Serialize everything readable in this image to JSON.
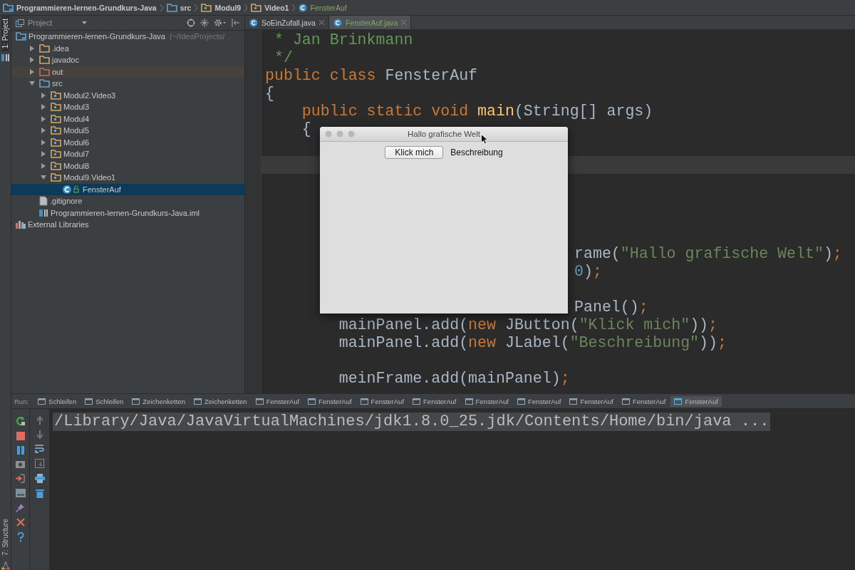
{
  "breadcrumbs": [
    {
      "label": "Programmieren-lernen-Grundkurs-Java",
      "kind": "project"
    },
    {
      "label": "src",
      "kind": "source"
    },
    {
      "label": "Modul9",
      "kind": "package"
    },
    {
      "label": "Video1",
      "kind": "package"
    },
    {
      "label": "FensterAuf",
      "kind": "class"
    }
  ],
  "left_strip": {
    "top_tab": {
      "label": "1: Project",
      "selected": true
    },
    "bottom_tab": {
      "label": "7: Structure",
      "selected": false
    }
  },
  "project_panel": {
    "title": "Project",
    "tree": [
      {
        "label": "Programmieren-lernen-Grundkurs-Java",
        "detail": "(~/IdeaProjects/",
        "kind": "project",
        "selected": false,
        "children": [
          {
            "label": ".idea",
            "kind": "folder",
            "expanded": false,
            "selected": false
          },
          {
            "label": "javadoc",
            "kind": "folder",
            "expanded": false,
            "selected": false
          },
          {
            "label": "out",
            "kind": "excluded",
            "expanded": false,
            "selected": false
          },
          {
            "label": "src",
            "kind": "source",
            "expanded": true,
            "selected": false,
            "children": [
              {
                "label": "Modul2.Video3",
                "kind": "package",
                "expanded": false,
                "selected": false
              },
              {
                "label": "Modul3",
                "kind": "package",
                "expanded": false,
                "selected": false
              },
              {
                "label": "Modul4",
                "kind": "package",
                "expanded": false,
                "selected": false
              },
              {
                "label": "Modul5",
                "kind": "package",
                "expanded": false,
                "selected": false
              },
              {
                "label": "Modul6",
                "kind": "package",
                "expanded": false,
                "selected": false
              },
              {
                "label": "Modul7",
                "kind": "package",
                "expanded": false,
                "selected": false
              },
              {
                "label": "Modul8",
                "kind": "package",
                "expanded": false,
                "selected": false
              },
              {
                "label": "Modul9.Video1",
                "kind": "package",
                "expanded": true,
                "selected": false,
                "children": [
                  {
                    "label": "FensterAuf",
                    "kind": "class",
                    "selected": true
                  }
                ]
              }
            ]
          },
          {
            "label": ".gitignore",
            "kind": "file",
            "selected": false
          },
          {
            "label": "Programmieren-lernen-Grundkurs-Java.iml",
            "kind": "iml",
            "selected": false
          }
        ]
      },
      {
        "label": "External Libraries",
        "kind": "libraries",
        "selected": false
      }
    ]
  },
  "editor": {
    "tabs": [
      {
        "label": "SoEinZufall.java",
        "selected": false
      },
      {
        "label": "FensterAuf.java",
        "selected": true
      }
    ],
    "lines": [
      {
        "kind": "code",
        "current": false,
        "tokens": [
          {
            "kind": "doc",
            "text": " * Jan Brinkmann"
          }
        ]
      },
      {
        "kind": "code",
        "current": false,
        "tokens": [
          {
            "kind": "doc",
            "text": " */"
          }
        ]
      },
      {
        "kind": "code",
        "current": false,
        "tokens": [
          {
            "kind": "keyword",
            "text": "public class "
          },
          {
            "kind": "plain",
            "text": "FensterAuf"
          }
        ]
      },
      {
        "kind": "code",
        "current": false,
        "tokens": [
          {
            "kind": "plain",
            "text": "{"
          }
        ]
      },
      {
        "kind": "code",
        "current": false,
        "tokens": [
          {
            "kind": "keyword",
            "text": "    public static void "
          },
          {
            "kind": "method",
            "text": "main"
          },
          {
            "kind": "plain",
            "text": "(String[] args)"
          }
        ]
      },
      {
        "kind": "code",
        "current": false,
        "tokens": [
          {
            "kind": "plain",
            "text": "    {"
          }
        ]
      },
      {
        "kind": "code",
        "current": false
      },
      {
        "kind": "code",
        "current": true
      },
      {
        "kind": "code",
        "current": false
      },
      {
        "kind": "code",
        "current": false
      },
      {
        "kind": "code",
        "current": false
      },
      {
        "kind": "code",
        "current": false
      },
      {
        "kind": "partial",
        "current": false,
        "tokens": [
          {
            "kind": "plain",
            "text": "rame("
          },
          {
            "kind": "string",
            "text": "\"Hallo grafische Welt\""
          },
          {
            "kind": "plain",
            "text": ")"
          },
          {
            "kind": "keyword",
            "text": ";"
          }
        ]
      },
      {
        "kind": "partial",
        "current": false,
        "tokens": [
          {
            "kind": "number",
            "text": "0"
          },
          {
            "kind": "plain",
            "text": ")"
          },
          {
            "kind": "keyword",
            "text": ";"
          }
        ]
      },
      {
        "kind": "code",
        "current": false
      },
      {
        "kind": "partial",
        "current": false,
        "tokens": [
          {
            "kind": "plain",
            "text": "Panel()"
          },
          {
            "kind": "keyword",
            "text": ";"
          }
        ]
      },
      {
        "kind": "code",
        "current": false,
        "tokens": [
          {
            "kind": "plain",
            "text": "        mainPanel.add("
          },
          {
            "kind": "keyword",
            "text": "new"
          },
          {
            "kind": "plain",
            "text": " JButton("
          },
          {
            "kind": "string",
            "text": "\"Klick mich\""
          },
          {
            "kind": "plain",
            "text": "))"
          },
          {
            "kind": "keyword",
            "text": ";"
          }
        ]
      },
      {
        "kind": "code",
        "current": false,
        "tokens": [
          {
            "kind": "plain",
            "text": "        mainPanel.add("
          },
          {
            "kind": "keyword",
            "text": "new"
          },
          {
            "kind": "plain",
            "text": " JLabel("
          },
          {
            "kind": "string",
            "text": "\"Beschreibung\""
          },
          {
            "kind": "plain",
            "text": "))"
          },
          {
            "kind": "keyword",
            "text": ";"
          }
        ]
      },
      {
        "kind": "code",
        "current": false
      },
      {
        "kind": "code",
        "current": false,
        "tokens": [
          {
            "kind": "plain",
            "text": "        meinFrame.add(mainPanel)"
          },
          {
            "kind": "keyword",
            "text": ";"
          }
        ]
      }
    ]
  },
  "app_window": {
    "title": "Hallo grafische Welt",
    "button": "Klick mich",
    "label": "Beschreibung"
  },
  "run": {
    "label": "Run:",
    "tabs": [
      {
        "label": "Schleifen",
        "selected": false
      },
      {
        "label": "Schleifen",
        "selected": false
      },
      {
        "label": "Zeichenketten",
        "selected": false
      },
      {
        "label": "Zeichenketten",
        "selected": false
      },
      {
        "label": "FensterAuf",
        "selected": false
      },
      {
        "label": "FensterAuf",
        "selected": false
      },
      {
        "label": "FensterAuf",
        "selected": false
      },
      {
        "label": "FensterAuf",
        "selected": false
      },
      {
        "label": "FensterAuf",
        "selected": false
      },
      {
        "label": "FensterAuf",
        "selected": false
      },
      {
        "label": "FensterAuf",
        "selected": false
      },
      {
        "label": "FensterAuf",
        "selected": false
      },
      {
        "label": "FensterAuf",
        "selected": true
      }
    ],
    "output": "/Library/Java/JavaVirtualMachines/jdk1.8.0_25.jdk/Contents/Home/bin/java ..."
  }
}
